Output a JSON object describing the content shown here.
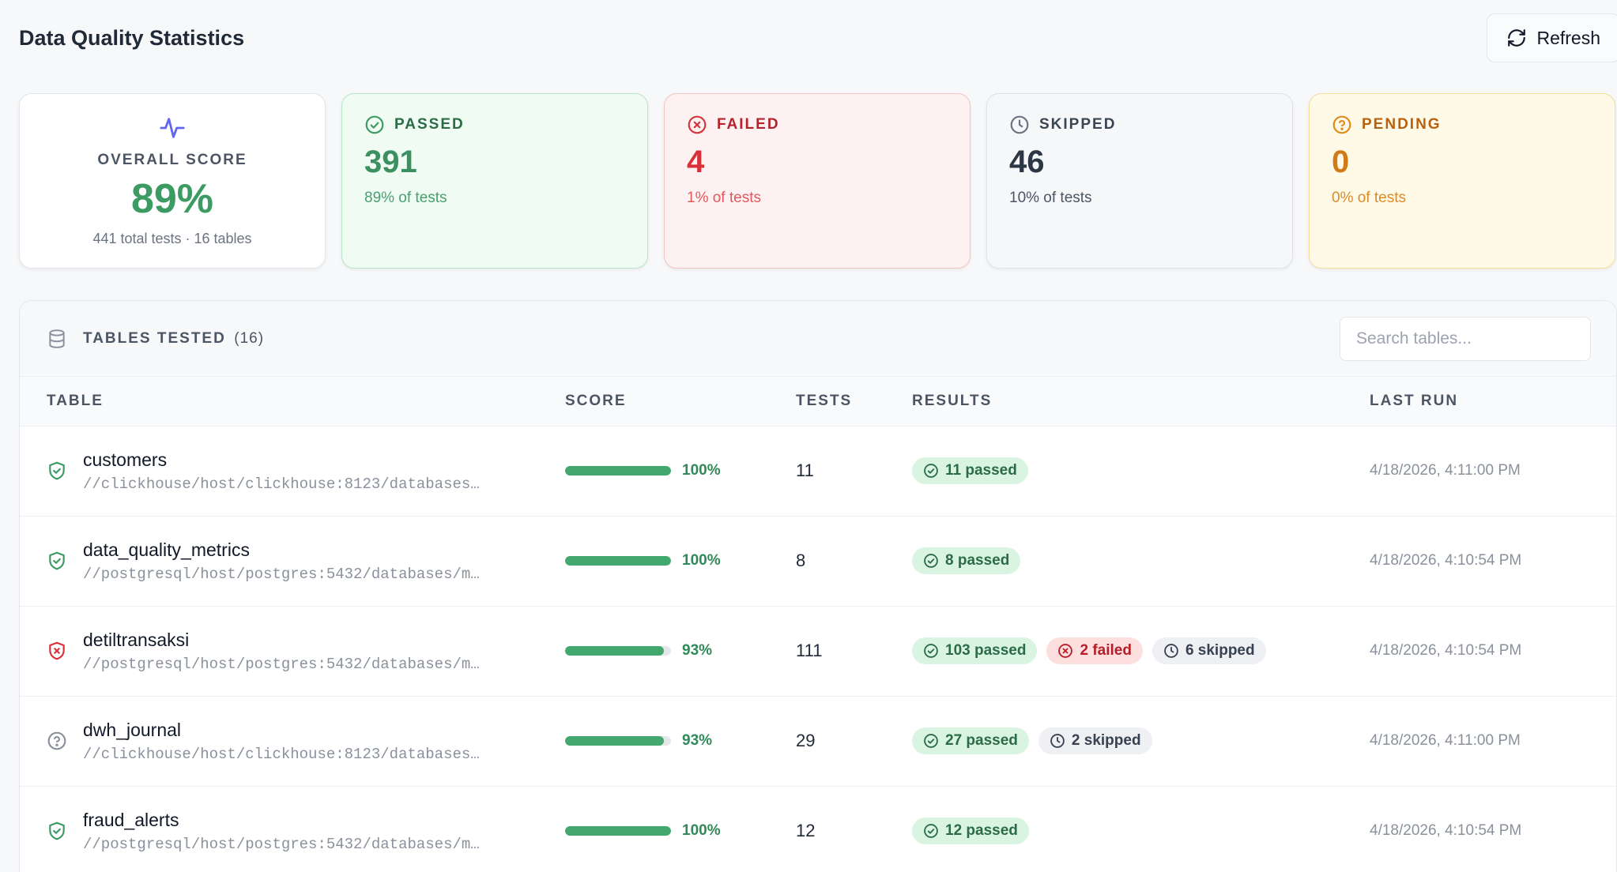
{
  "header": {
    "title": "Data Quality Statistics",
    "refresh_label": "Refresh"
  },
  "summary": {
    "overall": {
      "label": "OVERALL SCORE",
      "value": "89%",
      "sub": "441 total tests · 16 tables"
    },
    "passed": {
      "label": "PASSED",
      "count": "391",
      "pct": "89% of tests"
    },
    "failed": {
      "label": "FAILED",
      "count": "4",
      "pct": "1% of tests"
    },
    "skipped": {
      "label": "SKIPPED",
      "count": "46",
      "pct": "10% of tests"
    },
    "pending": {
      "label": "PENDING",
      "count": "0",
      "pct": "0% of tests"
    }
  },
  "tables_panel": {
    "title": "TABLES TESTED",
    "count": "(16)",
    "search_placeholder": "Search tables..."
  },
  "columns": [
    "TABLE",
    "SCORE",
    "TESTS",
    "RESULTS",
    "LAST RUN"
  ],
  "rows": [
    {
      "name": "customers",
      "path": "//clickhouse/host/clickhouse:8123/databases…",
      "status_icon": "shield-check-icon",
      "score": "100%",
      "score_value": 100,
      "tests": "11",
      "passed": "11 passed",
      "failed": "",
      "skipped": "",
      "last_run": "4/18/2026, 4:11:00 PM"
    },
    {
      "name": "data_quality_metrics",
      "path": "//postgresql/host/postgres:5432/databases/m…",
      "status_icon": "shield-check-icon",
      "score": "100%",
      "score_value": 100,
      "tests": "8",
      "passed": "8 passed",
      "failed": "",
      "skipped": "",
      "last_run": "4/18/2026, 4:10:54 PM"
    },
    {
      "name": "detiltransaksi",
      "path": "//postgresql/host/postgres:5432/databases/m…",
      "status_icon": "shield-x-icon",
      "score": "93%",
      "score_value": 93,
      "tests": "111",
      "passed": "103 passed",
      "failed": "2 failed",
      "skipped": "6 skipped",
      "last_run": "4/18/2026, 4:10:54 PM"
    },
    {
      "name": "dwh_journal",
      "path": "//clickhouse/host/clickhouse:8123/databases…",
      "status_icon": "question-circle-icon",
      "score": "93%",
      "score_value": 93,
      "tests": "29",
      "passed": "27 passed",
      "failed": "",
      "skipped": "2 skipped",
      "last_run": "4/18/2026, 4:11:00 PM"
    },
    {
      "name": "fraud_alerts",
      "path": "//postgresql/host/postgres:5432/databases/m…",
      "status_icon": "shield-check-icon",
      "score": "100%",
      "score_value": 100,
      "tests": "12",
      "passed": "12 passed",
      "failed": "",
      "skipped": "",
      "last_run": "4/18/2026, 4:10:54 PM"
    }
  ],
  "colors": {
    "pass": "#43a86d",
    "fail": "#d6323a",
    "skip": "#6b7280",
    "pending": "#d17a18",
    "accent": "#6366f1"
  }
}
